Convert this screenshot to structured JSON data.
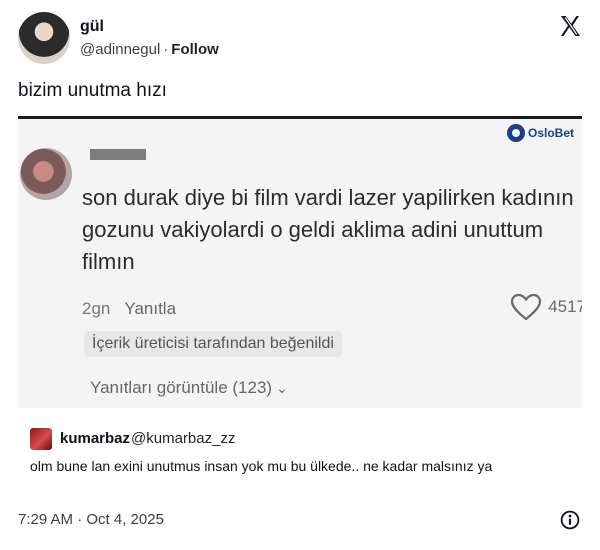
{
  "author": {
    "display_name": "gül",
    "handle": "@adinnegul",
    "separator": "·",
    "follow_label": "Follow"
  },
  "tweet": {
    "text": "bizim unutma hızı"
  },
  "media": {
    "brand": "OsloBet",
    "comment": {
      "text": "son durak  diye bi film vardi lazer yapilirken kadının gozunu vakiyolardi o geldi aklima adini unuttum filmın",
      "age": "2gn",
      "reply_label": "Yanıtla",
      "like_count": "4517",
      "badge": "İçerik üreticisi tarafından beğenildi",
      "view_replies": "Yanıtları görüntüle (123)",
      "chevron": "⌄"
    }
  },
  "quote": {
    "name": "kumarbaz",
    "handle": "@kumarbaz_zz",
    "text": "olm bune lan exini unutmus insan yok mu bu ülkede.. ne kadar malsınız ya"
  },
  "footer": {
    "timestamp": "7:29 AM · Oct 4, 2025"
  },
  "icons": {
    "x_logo": "x-logo-icon",
    "info": "info-icon",
    "heart": "heart-icon"
  },
  "colors": {
    "text": "#0f1419",
    "brand_blue": "#1d3f8a"
  }
}
